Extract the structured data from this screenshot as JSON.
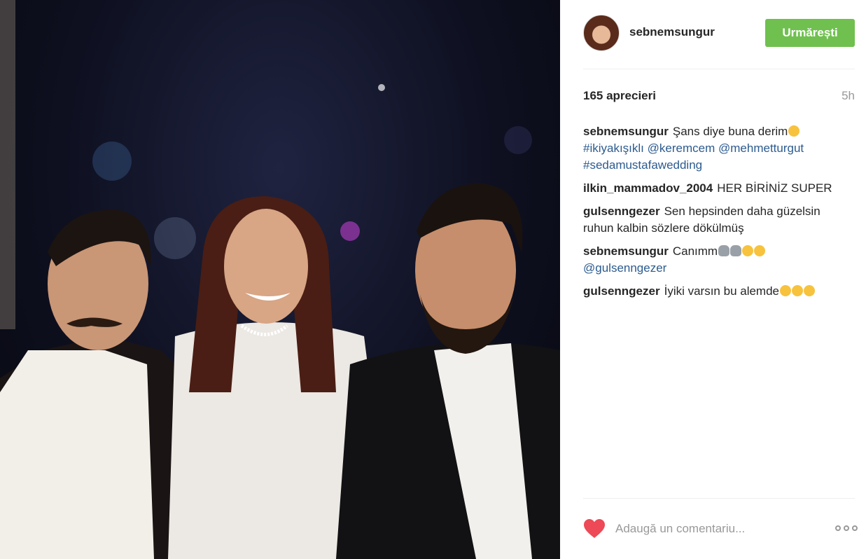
{
  "post": {
    "username": "sebnemsungur",
    "follow_label": "Urmărești",
    "likes": "165 aprecieri",
    "time": "5h",
    "comment_placeholder": "Adaugă un comentariu..."
  },
  "comments": [
    {
      "author": "sebnemsungur",
      "text": "Şans diye buna derim",
      "tags": [
        "#ikiyakışıklı",
        "@keremcem",
        "@mehmetturgut",
        "#sedamustafawedding"
      ]
    },
    {
      "author": "ilkin_mammadov_2004",
      "text": "HER BİRİNİZ SUPER"
    },
    {
      "author": "gulsenngezer",
      "text": "Sen hepsinden daha güzelsin ruhun kalbin sözlere dökülmüş"
    },
    {
      "author": "sebnemsungur",
      "text": "Canımm",
      "tags": [
        "@gulsenngezer"
      ]
    },
    {
      "author": "gulsenngezer",
      "text": "İyiki varsın bu alemde"
    }
  ],
  "colors": {
    "follow_button": "#70c050",
    "heart": "#ed4956",
    "link": "#2c5b8f"
  },
  "icons": [
    "heart-icon",
    "more-options-icon"
  ]
}
